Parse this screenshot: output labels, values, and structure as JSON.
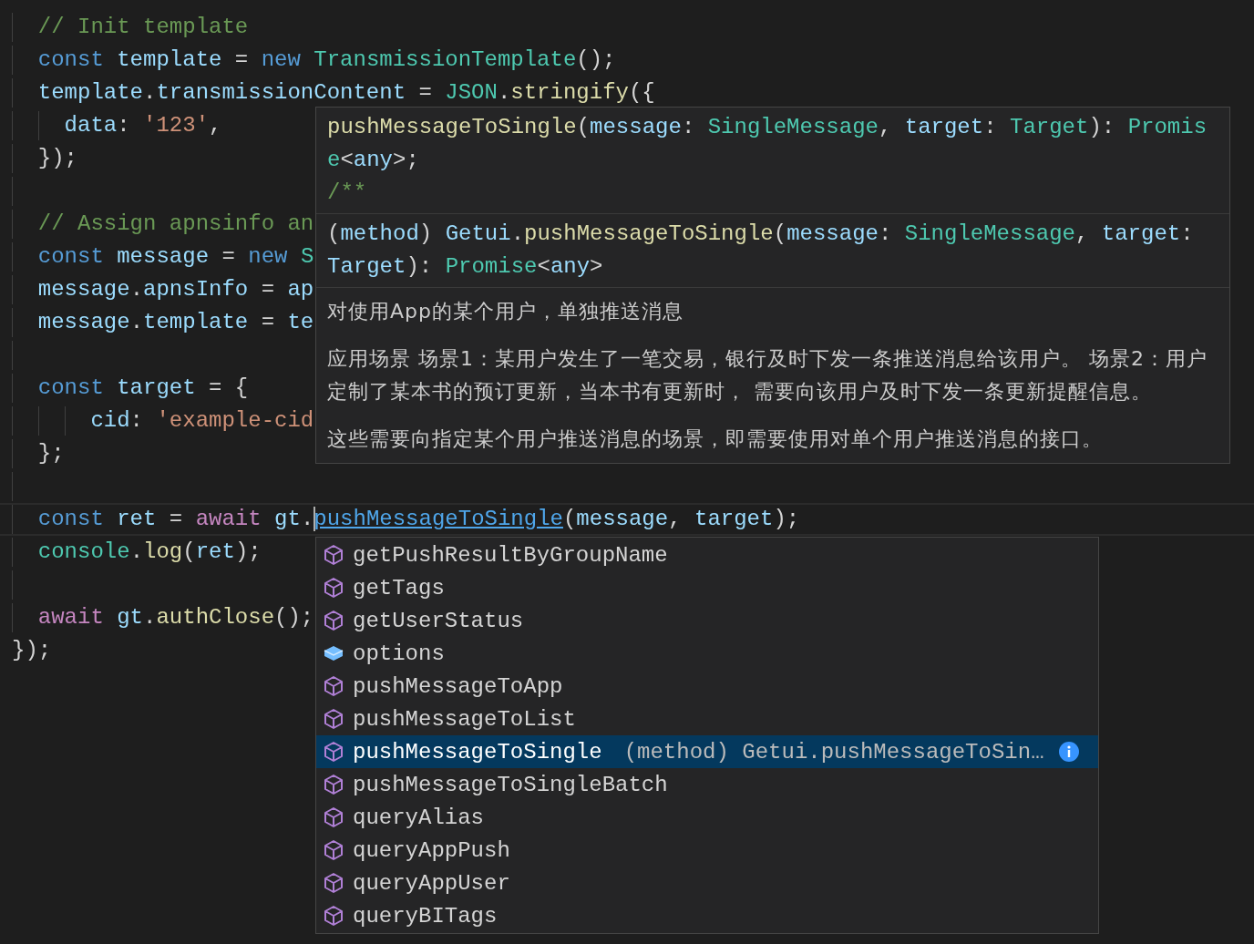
{
  "code_lines": [
    {
      "kind": "code",
      "tokens": [
        {
          "text": "  // Init template",
          "kind": "comment"
        }
      ]
    },
    {
      "kind": "code",
      "tokens": [
        {
          "text": "  const ",
          "kind": "keyword"
        },
        {
          "text": "template",
          "kind": "variable"
        },
        {
          "text": " = ",
          "kind": "plain"
        },
        {
          "text": "new ",
          "kind": "keyword"
        },
        {
          "text": "TransmissionTemplate",
          "kind": "type"
        },
        {
          "text": "();",
          "kind": "plain"
        }
      ]
    },
    {
      "kind": "code",
      "tokens": [
        {
          "text": "  template",
          "kind": "variable"
        },
        {
          "text": ".",
          "kind": "plain"
        },
        {
          "text": "transmissionContent",
          "kind": "variable"
        },
        {
          "text": " = ",
          "kind": "plain"
        },
        {
          "text": "JSON",
          "kind": "type"
        },
        {
          "text": ".",
          "kind": "plain"
        },
        {
          "text": "stringify",
          "kind": "function"
        },
        {
          "text": "({",
          "kind": "plain"
        }
      ]
    },
    {
      "kind": "code",
      "tokens": [
        {
          "text": "    data",
          "kind": "variable"
        },
        {
          "text": ": ",
          "kind": "plain"
        },
        {
          "text": "'123'",
          "kind": "string"
        },
        {
          "text": ",",
          "kind": "plain"
        }
      ]
    },
    {
      "kind": "code",
      "tokens": [
        {
          "text": "  });",
          "kind": "plain"
        }
      ]
    },
    {
      "kind": "blank"
    },
    {
      "kind": "code",
      "tokens": [
        {
          "text": "  // Assign apnsinfo an",
          "kind": "comment"
        }
      ]
    },
    {
      "kind": "code",
      "tokens": [
        {
          "text": "  const ",
          "kind": "keyword"
        },
        {
          "text": "message",
          "kind": "variable"
        },
        {
          "text": " = ",
          "kind": "plain"
        },
        {
          "text": "new ",
          "kind": "keyword"
        },
        {
          "text": "S",
          "kind": "type"
        }
      ]
    },
    {
      "kind": "code",
      "tokens": [
        {
          "text": "  message",
          "kind": "variable"
        },
        {
          "text": ".",
          "kind": "plain"
        },
        {
          "text": "apnsInfo",
          "kind": "variable"
        },
        {
          "text": " = ",
          "kind": "plain"
        },
        {
          "text": "ap",
          "kind": "variable"
        }
      ]
    },
    {
      "kind": "code",
      "tokens": [
        {
          "text": "  message",
          "kind": "variable"
        },
        {
          "text": ".",
          "kind": "plain"
        },
        {
          "text": "template",
          "kind": "variable"
        },
        {
          "text": " = ",
          "kind": "plain"
        },
        {
          "text": "te",
          "kind": "variable"
        }
      ]
    },
    {
      "kind": "blank"
    },
    {
      "kind": "code",
      "tokens": [
        {
          "text": "  const ",
          "kind": "keyword"
        },
        {
          "text": "target",
          "kind": "variable"
        },
        {
          "text": " = {",
          "kind": "plain"
        }
      ]
    },
    {
      "kind": "code",
      "tokens": [
        {
          "text": "      cid",
          "kind": "variable"
        },
        {
          "text": ": ",
          "kind": "plain"
        },
        {
          "text": "'example-cid",
          "kind": "string"
        }
      ]
    },
    {
      "kind": "code",
      "tokens": [
        {
          "text": "  };",
          "kind": "plain"
        }
      ]
    },
    {
      "kind": "blank"
    },
    {
      "kind": "code",
      "current": true,
      "tokens": [
        {
          "text": "  const ",
          "kind": "keyword"
        },
        {
          "text": "ret",
          "kind": "variable"
        },
        {
          "text": " = ",
          "kind": "plain"
        },
        {
          "text": "await ",
          "kind": "control"
        },
        {
          "text": "gt",
          "kind": "variable"
        },
        {
          "text": ".",
          "kind": "plain"
        },
        {
          "text": "pushMessageToSingle",
          "kind": "link"
        },
        {
          "text": "(",
          "kind": "plain"
        },
        {
          "text": "message",
          "kind": "variable"
        },
        {
          "text": ", ",
          "kind": "plain"
        },
        {
          "text": "target",
          "kind": "variable"
        },
        {
          "text": ");",
          "kind": "plain"
        }
      ]
    },
    {
      "kind": "code",
      "tokens": [
        {
          "text": "  console",
          "kind": "type"
        },
        {
          "text": ".",
          "kind": "plain"
        },
        {
          "text": "log",
          "kind": "function"
        },
        {
          "text": "(",
          "kind": "plain"
        },
        {
          "text": "ret",
          "kind": "variable"
        },
        {
          "text": ");",
          "kind": "plain"
        }
      ]
    },
    {
      "kind": "blank"
    },
    {
      "kind": "code",
      "tokens": [
        {
          "text": "  await ",
          "kind": "control"
        },
        {
          "text": "gt",
          "kind": "variable"
        },
        {
          "text": ".",
          "kind": "plain"
        },
        {
          "text": "authClose",
          "kind": "function"
        },
        {
          "text": "();",
          "kind": "plain"
        }
      ]
    },
    {
      "kind": "code",
      "tokens": [
        {
          "text": "});",
          "kind": "plain"
        }
      ]
    }
  ],
  "hover": {
    "sections": [
      {
        "kind": "signature",
        "tokens": [
          {
            "text": "pushMessageToSingle",
            "kind": "function"
          },
          {
            "text": "(",
            "kind": "plain"
          },
          {
            "text": "message",
            "kind": "variable"
          },
          {
            "text": ": ",
            "kind": "plain"
          },
          {
            "text": "SingleMessage",
            "kind": "type"
          },
          {
            "text": ", ",
            "kind": "plain"
          },
          {
            "text": "target",
            "kind": "variable"
          },
          {
            "text": ": ",
            "kind": "plain"
          },
          {
            "text": "Target",
            "kind": "type"
          },
          {
            "text": "): ",
            "kind": "plain"
          },
          {
            "text": "Promise",
            "kind": "type"
          },
          {
            "text": "<",
            "kind": "plain"
          },
          {
            "text": "any",
            "kind": "variable"
          },
          {
            "text": ">;",
            "kind": "plain"
          }
        ],
        "comment": "/**"
      },
      {
        "kind": "detail",
        "tokens": [
          {
            "text": "(",
            "kind": "plain"
          },
          {
            "text": "method",
            "kind": "variable"
          },
          {
            "text": ") ",
            "kind": "plain"
          },
          {
            "text": "Getui",
            "kind": "variable"
          },
          {
            "text": ".",
            "kind": "plain"
          },
          {
            "text": "pushMessageToSingle",
            "kind": "function"
          },
          {
            "text": "(",
            "kind": "plain"
          },
          {
            "text": "message",
            "kind": "variable"
          },
          {
            "text": ": ",
            "kind": "plain"
          },
          {
            "text": "SingleMessage",
            "kind": "type"
          },
          {
            "text": ", ",
            "kind": "plain"
          },
          {
            "text": "target",
            "kind": "variable"
          },
          {
            "text": ": ",
            "kind": "plain"
          },
          {
            "text": "Target",
            "kind": "variable"
          },
          {
            "text": "): ",
            "kind": "plain"
          },
          {
            "text": "Promise",
            "kind": "type"
          },
          {
            "text": "<",
            "kind": "plain"
          },
          {
            "text": "any",
            "kind": "variable"
          },
          {
            "text": ">",
            "kind": "plain"
          }
        ]
      },
      {
        "kind": "docs",
        "paragraphs": [
          "对使用App的某个用户，单独推送消息",
          "应用场景 场景1：某用户发生了一笔交易，银行及时下发一条推送消息给该用户。 场景2：用户定制了某本书的预订更新，当本书有更新时， 需要向该用户及时下发一条更新提醒信息。",
          "这些需要向指定某个用户推送消息的场景，即需要使用对单个用户推送消息的接口。"
        ]
      }
    ]
  },
  "suggestions": [
    {
      "label": "getPushResultByGroupName",
      "kind": "method",
      "selected": false
    },
    {
      "label": "getTags",
      "kind": "method",
      "selected": false
    },
    {
      "label": "getUserStatus",
      "kind": "method",
      "selected": false
    },
    {
      "label": "options",
      "kind": "property",
      "selected": false
    },
    {
      "label": "pushMessageToApp",
      "kind": "method",
      "selected": false
    },
    {
      "label": "pushMessageToList",
      "kind": "method",
      "selected": false
    },
    {
      "label": "pushMessageToSingle",
      "kind": "method",
      "selected": true,
      "detail": "(method) Getui.pushMessageToSin…"
    },
    {
      "label": "pushMessageToSingleBatch",
      "kind": "method",
      "selected": false
    },
    {
      "label": "queryAlias",
      "kind": "method",
      "selected": false
    },
    {
      "label": "queryAppPush",
      "kind": "method",
      "selected": false
    },
    {
      "label": "queryAppUser",
      "kind": "method",
      "selected": false
    },
    {
      "label": "queryBITags",
      "kind": "method",
      "selected": false
    }
  ]
}
